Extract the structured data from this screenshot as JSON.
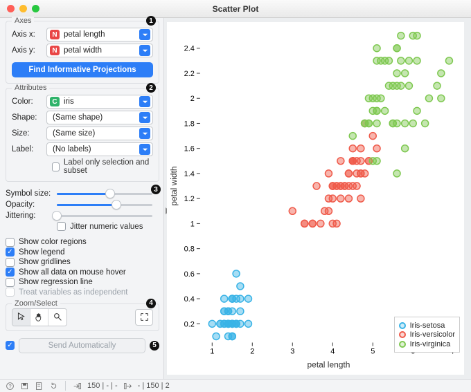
{
  "window": {
    "title": "Scatter Plot"
  },
  "axes": {
    "title": "Axes",
    "badge": "1",
    "x_label": "Axis x:",
    "y_label": "Axis y:",
    "x_value": "petal length",
    "y_value": "petal width",
    "button": "Find Informative Projections"
  },
  "attrs": {
    "title": "Attributes",
    "badge": "2",
    "color_label": "Color:",
    "color_value": "iris",
    "shape_label": "Shape:",
    "shape_value": "(Same shape)",
    "size_label": "Size:",
    "size_value": "(Same size)",
    "label_label": "Label:",
    "label_value": "(No labels)",
    "label_only": "Label only selection and subset"
  },
  "sliders": {
    "badge": "3",
    "symbol_label": "Symbol size:",
    "symbol_pct": 56,
    "opacity_label": "Opacity:",
    "opacity_pct": 62,
    "jitter_label": "Jittering:",
    "jitter_pct": 0,
    "jitter_numeric": "Jitter numeric values"
  },
  "opts": {
    "color_regions": "Show color regions",
    "legend": "Show legend",
    "gridlines": "Show gridlines",
    "mouse_hover": "Show all data on mouse hover",
    "regression": "Show regression line",
    "independent": "Treat variables as independent"
  },
  "zoom": {
    "title": "Zoom/Select",
    "badge": "4"
  },
  "send": {
    "badge": "5",
    "label": "Send Automatically",
    "checked": true
  },
  "status": {
    "in": "150 | - | -",
    "out": "- | 150 | 2"
  },
  "legend": [
    {
      "name": "Iris-setosa",
      "color": "#39b3e6"
    },
    {
      "name": "Iris-versicolor",
      "color": "#ef5a4a"
    },
    {
      "name": "Iris-virginica",
      "color": "#7ec850"
    }
  ],
  "chart_data": {
    "type": "scatter",
    "xlabel": "petal length",
    "ylabel": "petal width",
    "xlim": [
      0.7,
      7.1
    ],
    "ylim": [
      0.05,
      2.55
    ],
    "xticks": [
      1,
      2,
      3,
      4,
      5,
      6,
      7
    ],
    "yticks": [
      0.2,
      0.4,
      0.6,
      0.8,
      1,
      1.2,
      1.4,
      1.6,
      1.8,
      2,
      2.2,
      2.4
    ],
    "series": [
      {
        "name": "Iris-setosa",
        "color": "#39b3e6",
        "points": [
          [
            1.4,
            0.2
          ],
          [
            1.4,
            0.2
          ],
          [
            1.3,
            0.2
          ],
          [
            1.5,
            0.2
          ],
          [
            1.4,
            0.2
          ],
          [
            1.7,
            0.4
          ],
          [
            1.4,
            0.3
          ],
          [
            1.5,
            0.2
          ],
          [
            1.4,
            0.2
          ],
          [
            1.5,
            0.1
          ],
          [
            1.5,
            0.2
          ],
          [
            1.6,
            0.2
          ],
          [
            1.4,
            0.1
          ],
          [
            1.1,
            0.1
          ],
          [
            1.2,
            0.2
          ],
          [
            1.5,
            0.4
          ],
          [
            1.3,
            0.4
          ],
          [
            1.4,
            0.3
          ],
          [
            1.7,
            0.3
          ],
          [
            1.5,
            0.3
          ],
          [
            1.7,
            0.2
          ],
          [
            1.5,
            0.4
          ],
          [
            1.0,
            0.2
          ],
          [
            1.7,
            0.5
          ],
          [
            1.9,
            0.2
          ],
          [
            1.6,
            0.2
          ],
          [
            1.6,
            0.4
          ],
          [
            1.5,
            0.2
          ],
          [
            1.4,
            0.2
          ],
          [
            1.6,
            0.2
          ],
          [
            1.6,
            0.2
          ],
          [
            1.5,
            0.4
          ],
          [
            1.5,
            0.1
          ],
          [
            1.4,
            0.2
          ],
          [
            1.5,
            0.1
          ],
          [
            1.2,
            0.2
          ],
          [
            1.3,
            0.2
          ],
          [
            1.5,
            0.2
          ],
          [
            1.3,
            0.3
          ],
          [
            1.3,
            0.3
          ],
          [
            1.3,
            0.2
          ],
          [
            1.6,
            0.6
          ],
          [
            1.9,
            0.4
          ],
          [
            1.4,
            0.3
          ],
          [
            1.6,
            0.2
          ],
          [
            1.4,
            0.2
          ],
          [
            1.5,
            0.2
          ],
          [
            1.4,
            0.2
          ]
        ]
      },
      {
        "name": "Iris-versicolor",
        "color": "#ef5a4a",
        "points": [
          [
            4.7,
            1.4
          ],
          [
            4.5,
            1.5
          ],
          [
            4.9,
            1.5
          ],
          [
            4.0,
            1.3
          ],
          [
            4.6,
            1.5
          ],
          [
            4.5,
            1.3
          ],
          [
            4.7,
            1.6
          ],
          [
            3.3,
            1.0
          ],
          [
            4.6,
            1.3
          ],
          [
            3.9,
            1.4
          ],
          [
            3.5,
            1.0
          ],
          [
            4.2,
            1.5
          ],
          [
            4.0,
            1.0
          ],
          [
            4.7,
            1.4
          ],
          [
            3.6,
            1.3
          ],
          [
            4.4,
            1.4
          ],
          [
            4.5,
            1.5
          ],
          [
            4.1,
            1.0
          ],
          [
            4.5,
            1.5
          ],
          [
            3.9,
            1.1
          ],
          [
            4.8,
            1.8
          ],
          [
            4.0,
            1.3
          ],
          [
            4.9,
            1.5
          ],
          [
            4.7,
            1.2
          ],
          [
            4.3,
            1.3
          ],
          [
            4.4,
            1.4
          ],
          [
            4.8,
            1.4
          ],
          [
            5.0,
            1.7
          ],
          [
            4.5,
            1.5
          ],
          [
            3.5,
            1.0
          ],
          [
            3.8,
            1.1
          ],
          [
            3.7,
            1.0
          ],
          [
            3.9,
            1.2
          ],
          [
            5.1,
            1.6
          ],
          [
            4.5,
            1.5
          ],
          [
            4.5,
            1.6
          ],
          [
            4.7,
            1.5
          ],
          [
            4.4,
            1.3
          ],
          [
            4.1,
            1.3
          ],
          [
            4.0,
            1.3
          ],
          [
            4.4,
            1.2
          ],
          [
            4.6,
            1.4
          ],
          [
            4.0,
            1.2
          ],
          [
            3.3,
            1.0
          ],
          [
            4.2,
            1.3
          ],
          [
            4.2,
            1.2
          ],
          [
            4.2,
            1.3
          ],
          [
            4.3,
            1.3
          ],
          [
            3.0,
            1.1
          ],
          [
            4.1,
            1.3
          ]
        ]
      },
      {
        "name": "Iris-virginica",
        "color": "#7ec850",
        "points": [
          [
            6.0,
            2.5
          ],
          [
            5.1,
            1.9
          ],
          [
            5.9,
            2.1
          ],
          [
            5.6,
            1.8
          ],
          [
            5.8,
            2.2
          ],
          [
            6.6,
            2.1
          ],
          [
            4.5,
            1.7
          ],
          [
            6.3,
            1.8
          ],
          [
            5.8,
            1.8
          ],
          [
            6.1,
            2.5
          ],
          [
            5.1,
            2.0
          ],
          [
            5.3,
            1.9
          ],
          [
            5.5,
            2.1
          ],
          [
            5.0,
            2.0
          ],
          [
            5.1,
            2.4
          ],
          [
            5.3,
            2.3
          ],
          [
            5.5,
            1.8
          ],
          [
            6.7,
            2.2
          ],
          [
            6.9,
            2.3
          ],
          [
            5.0,
            1.5
          ],
          [
            5.7,
            2.3
          ],
          [
            4.9,
            2.0
          ],
          [
            6.7,
            2.0
          ],
          [
            4.9,
            1.8
          ],
          [
            5.7,
            2.1
          ],
          [
            6.0,
            1.8
          ],
          [
            4.8,
            1.8
          ],
          [
            4.9,
            1.8
          ],
          [
            5.6,
            2.1
          ],
          [
            5.8,
            1.6
          ],
          [
            6.1,
            1.9
          ],
          [
            6.4,
            2.0
          ],
          [
            5.6,
            2.2
          ],
          [
            5.1,
            1.5
          ],
          [
            5.6,
            1.4
          ],
          [
            6.1,
            2.3
          ],
          [
            5.6,
            2.4
          ],
          [
            5.5,
            1.8
          ],
          [
            4.8,
            1.8
          ],
          [
            5.4,
            2.1
          ],
          [
            5.6,
            2.4
          ],
          [
            5.1,
            2.3
          ],
          [
            5.1,
            1.9
          ],
          [
            5.9,
            2.3
          ],
          [
            5.7,
            2.5
          ],
          [
            5.2,
            2.3
          ],
          [
            5.0,
            1.9
          ],
          [
            5.2,
            2.0
          ],
          [
            5.4,
            2.3
          ],
          [
            5.1,
            1.8
          ]
        ]
      }
    ]
  }
}
